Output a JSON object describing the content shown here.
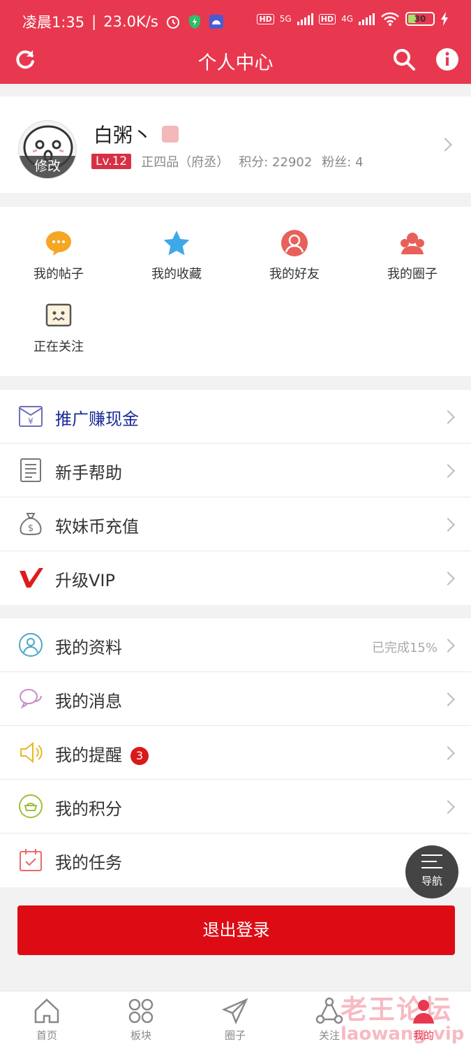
{
  "status_bar": {
    "time": "凌晨1:35",
    "speed": "23.0K/s",
    "signal1": "5G",
    "signal2": "4G",
    "hd": "HD",
    "battery": "30"
  },
  "header": {
    "title": "个人中心"
  },
  "profile": {
    "name": "白粥丶",
    "edit_label": "修改",
    "level": "Lv.12",
    "rank": "正四品（府丞）",
    "points": "积分: 22902",
    "fans": "粉丝: 4"
  },
  "quick_grid": [
    {
      "label": "我的帖子",
      "icon": "chat-bubble-icon",
      "color": "#f5a623"
    },
    {
      "label": "我的收藏",
      "icon": "star-icon",
      "color": "#3ea8e8"
    },
    {
      "label": "我的好友",
      "icon": "person-icon",
      "color": "#e8605a"
    },
    {
      "label": "我的圈子",
      "icon": "group-icon",
      "color": "#e8605a"
    },
    {
      "label": "正在关注",
      "icon": "face-box-icon",
      "color": "#555"
    }
  ],
  "menu_group1": [
    {
      "label": "推广赚现金",
      "icon": "envelope-yen-icon"
    },
    {
      "label": "新手帮助",
      "icon": "document-icon"
    },
    {
      "label": "软妹币充值",
      "icon": "money-bag-icon"
    },
    {
      "label": "升级VIP",
      "icon": "vip-v-icon"
    }
  ],
  "menu_group2": [
    {
      "label": "我的资料",
      "icon": "profile-icon",
      "right": "已完成15%"
    },
    {
      "label": "我的消息",
      "icon": "message-icon"
    },
    {
      "label": "我的提醒",
      "icon": "speaker-icon",
      "badge": "3"
    },
    {
      "label": "我的积分",
      "icon": "coin-icon"
    },
    {
      "label": "我的任务",
      "icon": "calendar-check-icon"
    }
  ],
  "logout_label": "退出登录",
  "fab_label": "导航",
  "tabs": [
    {
      "label": "首页",
      "icon": "home-icon"
    },
    {
      "label": "板块",
      "icon": "grid-icon"
    },
    {
      "label": "圈子",
      "icon": "paper-plane-icon"
    },
    {
      "label": "关注",
      "icon": "network-icon"
    },
    {
      "label": "我的",
      "icon": "user-icon",
      "active": true
    }
  ],
  "watermark": {
    "line1": "老王论坛",
    "line2": "laowang.vip"
  },
  "colors": {
    "brand": "#e8384f",
    "logout": "#dd0c14",
    "promo_text": "#1a2a9a"
  }
}
